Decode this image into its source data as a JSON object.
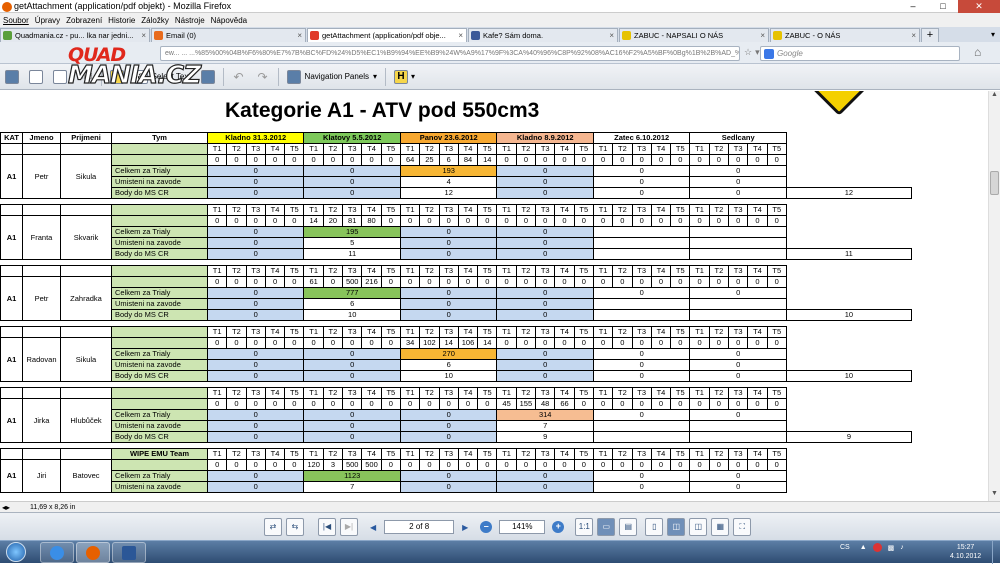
{
  "window": {
    "title": "getAttachment (application/pdf objekt) - Mozilla Firefox"
  },
  "menu": [
    "Soubor",
    "Úpravy",
    "Zobrazení",
    "Historie",
    "Záložky",
    "Nástroje",
    "Nápověda"
  ],
  "tabs": [
    {
      "label": "Quadmania.cz - pu... lka nar jedni...",
      "active": false,
      "color": "#5a9f3a"
    },
    {
      "label": "Email (0)",
      "active": false,
      "color": "#e86b1d"
    },
    {
      "label": "getAttachment (application/pdf obje...",
      "active": true,
      "color": "#e03a2a"
    },
    {
      "label": "Kafe? Sám doma.",
      "active": false,
      "color": "#3b5998"
    },
    {
      "label": "ZABUC - NAPSALI O NÁS",
      "active": false,
      "color": "#e6c200"
    },
    {
      "label": "ZABUC - O NÁS",
      "active": false,
      "color": "#e6c200"
    }
  ],
  "nav": {
    "url": "ew... ... ...%85%00%04B%F6%80%E7%7B%BC%FD%24%D5%EC1%B9%94%EE%B9%24W%A9%17%9F%3CA%40%96%C8P%92%08%AC16%F2%A5%BF%0Bg%1B%2B%AD_%CE%",
    "search_placeholder": "Google"
  },
  "logo": {
    "line1": "QUAD",
    "line2": "MANIA.CZ"
  },
  "pdf_toolbar": {
    "find": "Find",
    "select_text": "Select Text",
    "nav_panels": "Navigation Panels"
  },
  "sheet": {
    "title": "Kategorie A1 - ATV pod 550cm3",
    "col_headers": {
      "kat": "KAT",
      "jmeno": "Jmeno",
      "prijmeni": "Prijmeni",
      "tym": "Tym"
    },
    "events": [
      "Kladno 31.3.2012",
      "Klatovy 5.5.2012",
      "Panov 23.6.2012",
      "Kladno 8.9.2012",
      "Zatec 6.10.2012",
      "Sedlcany"
    ],
    "trial_labels": [
      "T1",
      "T2",
      "T3",
      "T4",
      "T5"
    ],
    "row_labels": {
      "celkem": "Celkem za Trialy",
      "umisteni": "Umisteni na zavode",
      "body": "Body do MS CR"
    },
    "riders": [
      {
        "kat": "A1",
        "jmeno": "Petr",
        "prijmeni": "Sikula",
        "tym": "",
        "trials": [
          [
            0,
            0,
            0,
            0,
            0
          ],
          [
            0,
            0,
            0,
            0,
            0
          ],
          [
            64,
            25,
            6,
            84,
            14
          ],
          [
            0,
            0,
            0,
            0,
            0
          ],
          [
            0,
            0,
            0,
            0,
            0
          ],
          [
            0,
            0,
            0,
            0,
            0
          ]
        ],
        "celkem": [
          "0",
          "0",
          "193",
          "0",
          "0",
          "0"
        ],
        "umisteni": [
          "0",
          "0",
          "4",
          "0",
          "0",
          "0"
        ],
        "body": [
          "0",
          "0",
          "12",
          "0",
          "0",
          "0"
        ],
        "total": "12",
        "hl": 2,
        "hlc": "vorange",
        "inline": false
      },
      {
        "kat": "A1",
        "jmeno": "Franta",
        "prijmeni": "Skvarik",
        "tym": "",
        "trials": [
          [
            0,
            0,
            0,
            0,
            0
          ],
          [
            14,
            20,
            81,
            80,
            0
          ],
          [
            0,
            0,
            0,
            0,
            0
          ],
          [
            0,
            0,
            0,
            0,
            0
          ],
          [
            0,
            0,
            0,
            0,
            0
          ],
          [
            0,
            0,
            0,
            0,
            0
          ]
        ],
        "celkem": [
          "0",
          "195",
          "0",
          "0",
          "",
          ""
        ],
        "umisteni": [
          "0",
          "5",
          "0",
          "0",
          "",
          ""
        ],
        "body": [
          "0",
          "11",
          "0",
          "0",
          "",
          ""
        ],
        "total": "11",
        "hl": 1,
        "hlc": "vgreen",
        "inline": false
      },
      {
        "kat": "A1",
        "jmeno": "Petr",
        "prijmeni": "Zahradka",
        "tym": "",
        "trials": [
          [
            0,
            0,
            0,
            0,
            0
          ],
          [
            61,
            0,
            500,
            216,
            0
          ],
          [
            0,
            0,
            0,
            0,
            0
          ],
          [
            0,
            0,
            0,
            0,
            0
          ],
          [
            0,
            0,
            0,
            0,
            0
          ],
          [
            0,
            0,
            0,
            0,
            0
          ]
        ],
        "celkem": [
          "0",
          "777",
          "0",
          "0",
          "0",
          "0"
        ],
        "umisteni": [
          "0",
          "6",
          "0",
          "0",
          "",
          ""
        ],
        "body": [
          "0",
          "10",
          "0",
          "0",
          "",
          ""
        ],
        "total": "10",
        "hl": 1,
        "hlc": "vgreen",
        "inline": true
      },
      {
        "kat": "A1",
        "jmeno": "Radovan",
        "prijmeni": "Sikula",
        "tym": "",
        "trials": [
          [
            0,
            0,
            0,
            0,
            0
          ],
          [
            0,
            0,
            0,
            0,
            0
          ],
          [
            34,
            102,
            14,
            106,
            14
          ],
          [
            0,
            0,
            0,
            0,
            0
          ],
          [
            0,
            0,
            0,
            0,
            0
          ],
          [
            0,
            0,
            0,
            0,
            0
          ]
        ],
        "celkem": [
          "0",
          "0",
          "270",
          "0",
          "0",
          "0"
        ],
        "umisteni": [
          "0",
          "0",
          "6",
          "0",
          "0",
          "0"
        ],
        "body": [
          "0",
          "0",
          "10",
          "0",
          "0",
          "0"
        ],
        "total": "10",
        "hl": 2,
        "hlc": "vorange",
        "inline": false
      },
      {
        "kat": "A1",
        "jmeno": "Jirka",
        "prijmeni": "Hlubůček",
        "tym": "",
        "trials": [
          [
            0,
            0,
            0,
            0,
            0
          ],
          [
            0,
            0,
            0,
            0,
            0
          ],
          [
            0,
            0,
            0,
            0,
            0
          ],
          [
            45,
            155,
            48,
            66,
            0
          ],
          [
            0,
            0,
            0,
            0,
            0
          ],
          [
            0,
            0,
            0,
            0,
            0
          ]
        ],
        "celkem": [
          "0",
          "0",
          "0",
          "314",
          "0",
          "0"
        ],
        "umisteni": [
          "0",
          "0",
          "0",
          "7",
          "",
          ""
        ],
        "body": [
          "0",
          "0",
          "0",
          "9",
          "",
          ""
        ],
        "total": "9",
        "hl": 3,
        "hlc": "vsalmon",
        "inline": true
      },
      {
        "kat": "A1",
        "jmeno": "Jiri",
        "prijmeni": "Batovec",
        "tym": "WIPE EMU Team",
        "trials": [
          [
            0,
            0,
            0,
            0,
            0
          ],
          [
            120,
            3,
            500,
            500,
            0
          ],
          [
            0,
            0,
            0,
            0,
            0
          ],
          [
            0,
            0,
            0,
            0,
            0
          ],
          [
            0,
            0,
            0,
            0,
            0
          ],
          [
            0,
            0,
            0,
            0,
            0
          ]
        ],
        "celkem": [
          "0",
          "1123",
          "0",
          "0",
          "0",
          "0"
        ],
        "umisteni": [
          "0",
          "7",
          "0",
          "0",
          "0",
          "0"
        ],
        "body": [
          "",
          "",
          "",
          "",
          "",
          ""
        ],
        "total": "",
        "hl": 1,
        "hlc": "vgreen",
        "inline": false,
        "partial": true
      }
    ]
  },
  "status": {
    "page_size": "11,69 x 8,26 in"
  },
  "bottom_toolbar": {
    "page_display": "2 of 8",
    "zoom": "141%"
  },
  "taskbar": {
    "lang": "CS",
    "time": "15:27",
    "date": "4.10.2012"
  }
}
